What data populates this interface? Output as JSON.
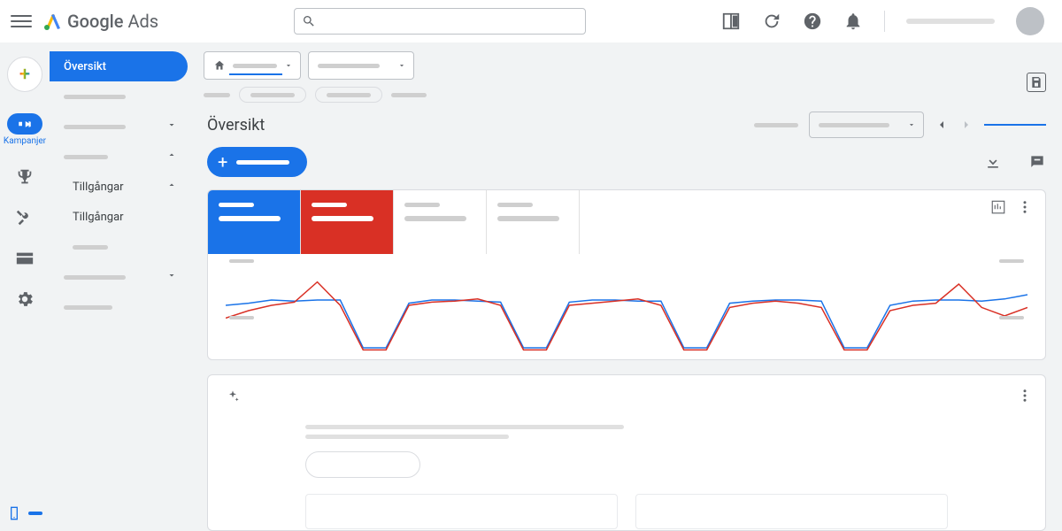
{
  "brand": {
    "name1": "Google",
    "name2": "Ads"
  },
  "rail": {
    "active_label": "Kampanjer"
  },
  "side": {
    "selected": "Översikt",
    "expanded_group": "Tillgångar",
    "expanded_item": "Tillgångar"
  },
  "page": {
    "title": "Översikt"
  },
  "metrics": {
    "items": [
      {
        "color": "blue"
      },
      {
        "color": "red"
      },
      {
        "color": "gray"
      },
      {
        "color": "gray"
      }
    ]
  },
  "chart_data": {
    "type": "line",
    "x": [
      0,
      1,
      2,
      3,
      4,
      5,
      6,
      7,
      8,
      9,
      10,
      11,
      12,
      13,
      14,
      15,
      16,
      17,
      18,
      19,
      20,
      21,
      22,
      23,
      24,
      25,
      26,
      27,
      28,
      29,
      30,
      31,
      32,
      33,
      34,
      35
    ],
    "series": [
      {
        "name": "metric-blue",
        "color": "#1a73e8",
        "values": [
          60,
          62,
          65,
          64,
          65,
          65,
          20,
          20,
          62,
          65,
          65,
          64,
          63,
          20,
          20,
          63,
          65,
          65,
          64,
          64,
          20,
          20,
          62,
          64,
          65,
          65,
          64,
          20,
          20,
          60,
          64,
          65,
          65,
          64,
          66,
          70
        ]
      },
      {
        "name": "metric-red",
        "color": "#d93025",
        "values": [
          48,
          55,
          60,
          63,
          82,
          60,
          18,
          18,
          60,
          63,
          64,
          66,
          60,
          18,
          18,
          60,
          62,
          64,
          66,
          60,
          18,
          18,
          58,
          62,
          64,
          62,
          58,
          18,
          18,
          55,
          60,
          62,
          80,
          58,
          50,
          58
        ]
      }
    ],
    "ylim": [
      0,
      100
    ]
  }
}
